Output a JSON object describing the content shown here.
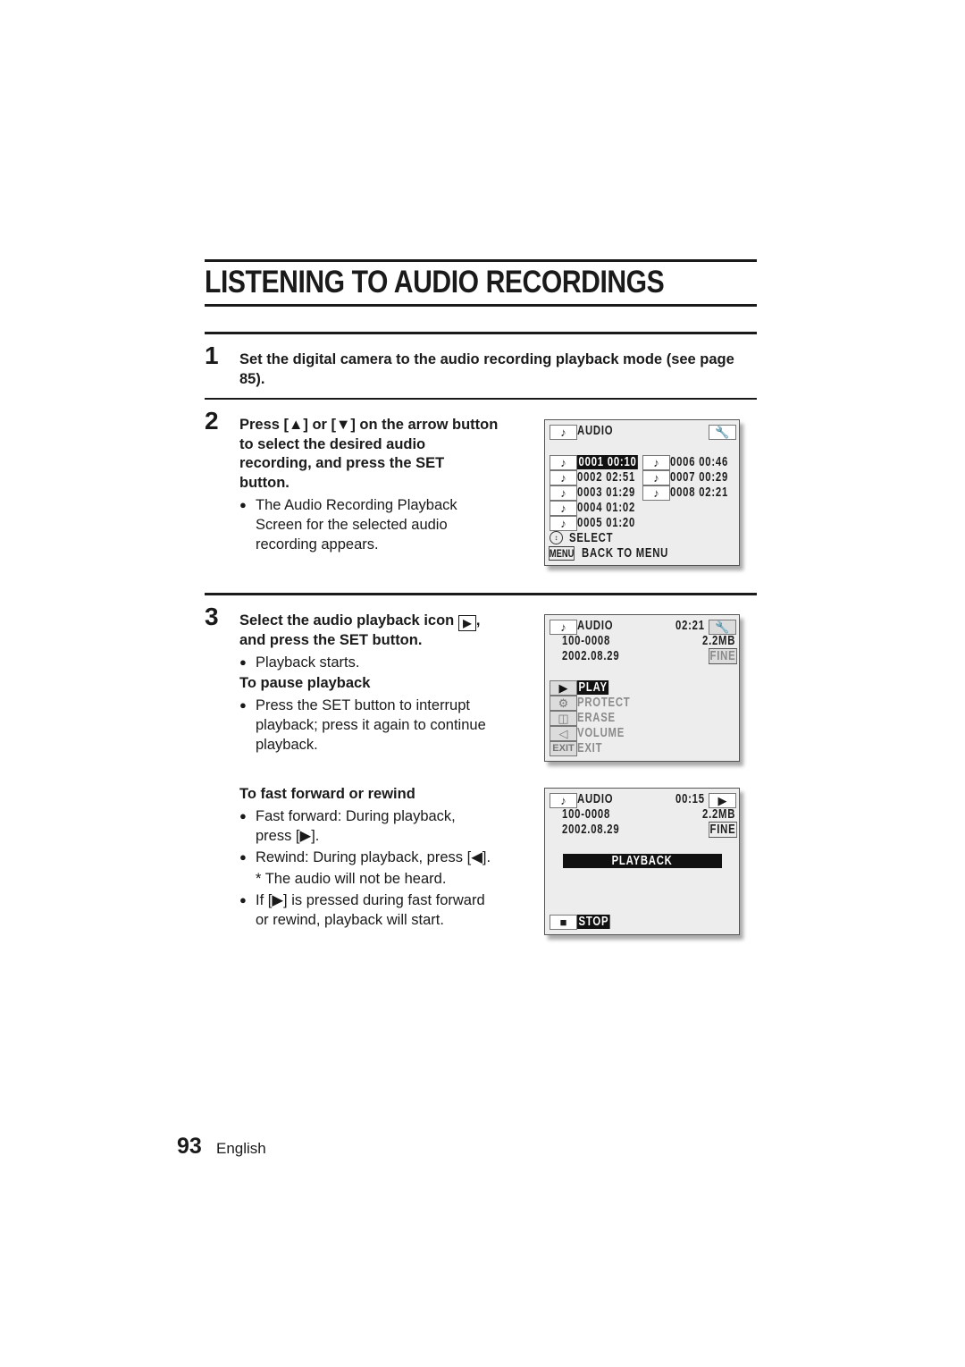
{
  "page": {
    "title": "LISTENING TO AUDIO RECORDINGS",
    "page_number": "93",
    "language": "English"
  },
  "steps": [
    {
      "number": "1",
      "instruction": "Set the digital camera to the audio recording playback mode (see page 85)."
    },
    {
      "number": "2",
      "instruction_lines": [
        "Press [▲] or [▼] on the arrow button",
        "to select the desired audio",
        "recording, and press the SET",
        "button."
      ],
      "bullets": [
        {
          "lines": [
            "The Audio Recording Playback",
            "Screen for the selected audio",
            "recording appears."
          ]
        }
      ]
    },
    {
      "number": "3",
      "instruction_lines": [
        "Select the audio playback icon",
        ",",
        "and press the SET button."
      ],
      "inline_icon": "▶",
      "bullets": [
        {
          "lines": [
            "Playback starts."
          ]
        }
      ],
      "subsections": [
        {
          "heading": "To pause playback",
          "bullets": [
            {
              "lines": [
                "Press the SET button to interrupt",
                "playback; press it again to continue",
                "playback."
              ]
            }
          ]
        },
        {
          "heading": "To fast forward or rewind",
          "bullets": [
            {
              "lines": [
                "Fast forward: During playback,",
                "press [▶]."
              ]
            },
            {
              "lines": [
                "Rewind: During playback, press [◀]."
              ]
            },
            {
              "lines": [
                "If [▶] is pressed during fast forward",
                "or rewind, playback will start."
              ]
            }
          ],
          "note": "*  The audio will not be heard."
        }
      ]
    }
  ],
  "screens": {
    "select_screen": {
      "header": "AUDIO",
      "header_icon": "note-icon",
      "tool_icon": "wrench-icon",
      "recordings": [
        {
          "id": "0001",
          "length": "00:10",
          "selected": true
        },
        {
          "id": "0002",
          "length": "02:51"
        },
        {
          "id": "0003",
          "length": "01:29"
        },
        {
          "id": "0004",
          "length": "01:02"
        },
        {
          "id": "0005",
          "length": "01:20"
        },
        {
          "id": "0006",
          "length": "00:46"
        },
        {
          "id": "0007",
          "length": "00:29"
        },
        {
          "id": "0008",
          "length": "02:21"
        }
      ],
      "select_label": "SELECT",
      "menu_label": "MENU",
      "back_label": "BACK TO MENU"
    },
    "menu_screen": {
      "header": "AUDIO",
      "time": "02:21",
      "file": "100-0008",
      "size": "2.2MB",
      "date": "2002.08.29",
      "quality": "FINE",
      "menu": [
        {
          "icon": "▶",
          "label": "PLAY",
          "active": true
        },
        {
          "icon": "⚿",
          "label": "PROTECT"
        },
        {
          "icon": "Ὕ1",
          "label": "ERASE"
        },
        {
          "icon": "◁",
          "label": "VOLUME"
        },
        {
          "icon": "EXIT",
          "label": "EXIT"
        }
      ]
    },
    "playback_screen": {
      "header": "AUDIO",
      "time": "00:15",
      "file": "100-0008",
      "size": "2.2MB",
      "date": "2002.08.29",
      "quality": "FINE",
      "status": "PLAYBACK",
      "stop_icon": "■",
      "stop_label": "STOP"
    }
  }
}
